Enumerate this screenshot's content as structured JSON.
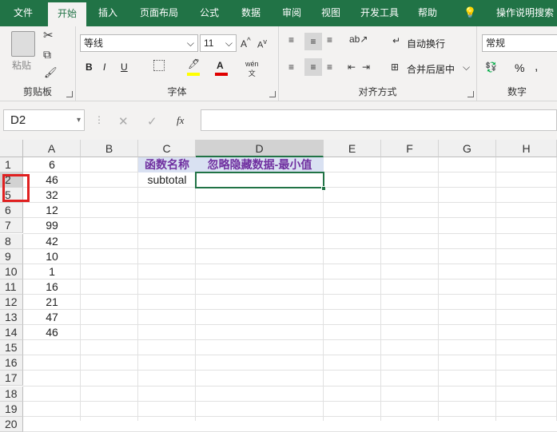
{
  "tabs": [
    "文件",
    "开始",
    "插入",
    "页面布局",
    "公式",
    "数据",
    "审阅",
    "视图",
    "开发工具",
    "帮助",
    "操作说明搜索"
  ],
  "ribbon": {
    "clipboard": {
      "label": "剪贴板",
      "paste": "粘贴"
    },
    "font": {
      "label": "字体",
      "name": "等线",
      "size": "11",
      "bold": "B",
      "italic": "I",
      "underline": "U",
      "wen": "wén\n文"
    },
    "align": {
      "label": "对齐方式",
      "wrap": "自动换行",
      "merge": "合并后居中"
    },
    "number": {
      "label": "数字",
      "format": "常规",
      "percent": "%"
    }
  },
  "namebox": "D2",
  "fx": "fx",
  "columns": [
    "A",
    "B",
    "C",
    "D",
    "E",
    "F",
    "G",
    "H"
  ],
  "rows": [
    "1",
    "2",
    "5",
    "6",
    "7",
    "8",
    "9",
    "10",
    "11",
    "12",
    "13",
    "14",
    "15",
    "16",
    "17",
    "18",
    "19",
    "20"
  ],
  "colA": [
    "6",
    "46",
    "32",
    "12",
    "99",
    "42",
    "10",
    "1",
    "16",
    "21",
    "47",
    "46"
  ],
  "c1": "函数名称",
  "c2": "subtotal",
  "d1": "忽略隐藏数据-最小值",
  "colors": {
    "brand": "#217346",
    "header_fill": "#d9e1f2",
    "header_text": "#7030a0",
    "highlight": "#e02020"
  }
}
